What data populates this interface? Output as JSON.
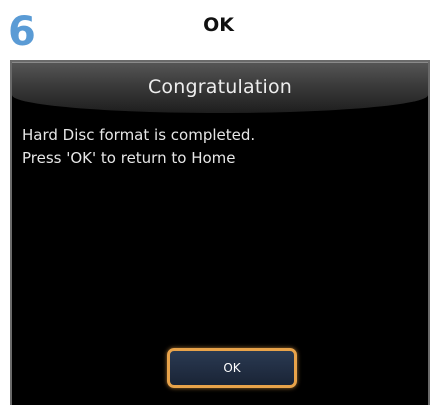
{
  "step": {
    "number": "6",
    "title": "OK"
  },
  "dialog": {
    "title": "Congratulation",
    "message_line1": "Hard Disc format is completed.",
    "message_line2": "Press 'OK' to return to Home",
    "ok_label": "OK"
  },
  "colors": {
    "step_number": "#5a9bd5",
    "screen_background": "#000000",
    "button_border": "#e8a34a",
    "button_fill": "#1f2c42"
  }
}
